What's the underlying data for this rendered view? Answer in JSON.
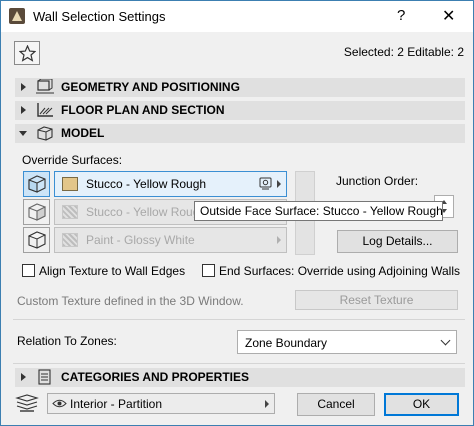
{
  "window": {
    "title": "Wall Selection Settings",
    "help_label": "?",
    "close_label": "✕"
  },
  "header": {
    "selected_info": "Selected: 2 Editable: 2"
  },
  "panels": {
    "geometry": "GEOMETRY AND POSITIONING",
    "floorplan": "FLOOR PLAN AND SECTION",
    "model": "MODEL",
    "categories": "CATEGORIES AND PROPERTIES"
  },
  "model": {
    "override_label": "Override Surfaces:",
    "surfaces": [
      {
        "label": "Stucco - Yellow Rough",
        "state": "active"
      },
      {
        "label": "Stucco - Yellow Rough",
        "state": "dim"
      },
      {
        "label": "Paint - Glossy White",
        "state": "dim"
      }
    ],
    "tooltip": "Outside Face Surface: Stucco - Yellow Rough",
    "junction_label": "Junction Order:",
    "log_details": "Log Details...",
    "align_texture_label": "Align Texture to Wall Edges",
    "end_surfaces_label": "End Surfaces: Override using Adjoining Walls",
    "custom_texture_note": "Custom Texture defined in the 3D Window.",
    "reset_texture": "Reset Texture"
  },
  "zones": {
    "label": "Relation To Zones:",
    "value": "Zone Boundary"
  },
  "footer": {
    "layer": "Interior - Partition",
    "cancel": "Cancel",
    "ok": "OK"
  }
}
